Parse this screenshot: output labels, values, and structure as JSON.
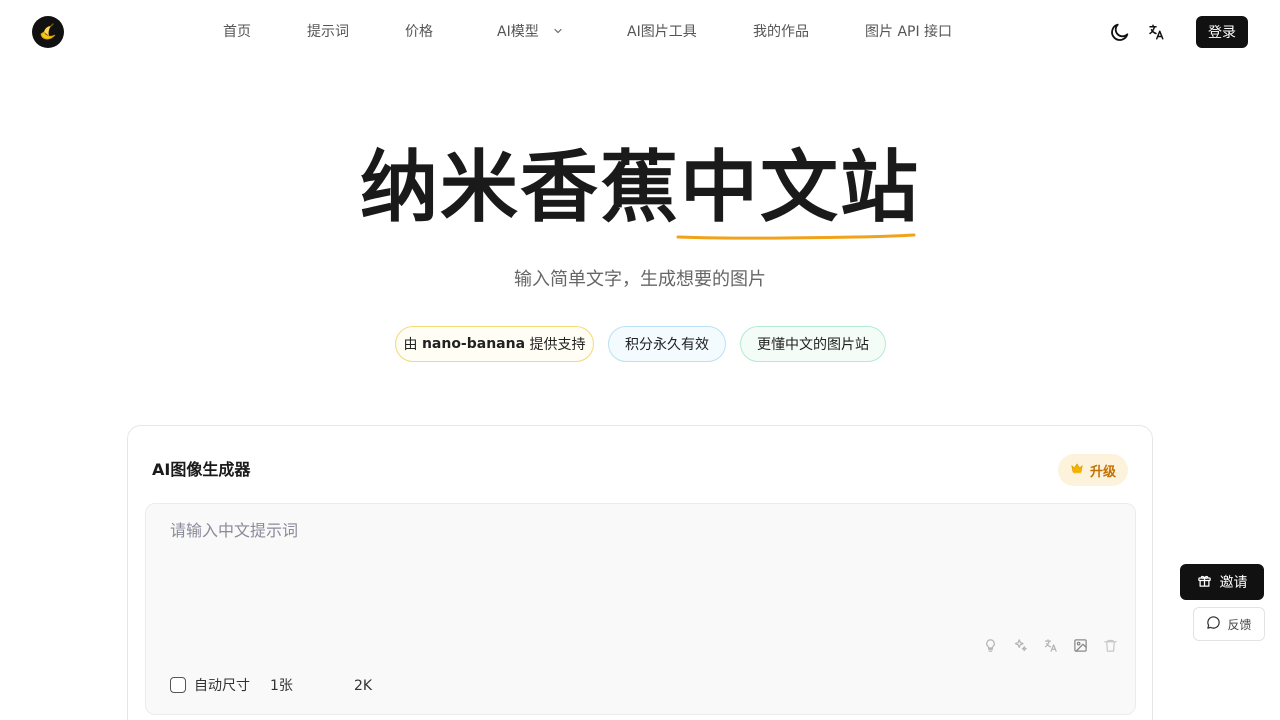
{
  "nav": {
    "logo_icon": "banana-logo-icon",
    "links": [
      {
        "label": "首页"
      },
      {
        "label": "提示词"
      },
      {
        "label": "价格"
      },
      {
        "label": "AI模型"
      },
      {
        "label": "AI图片工具"
      },
      {
        "label": "我的作品"
      },
      {
        "label": "图片 API 接口"
      }
    ],
    "theme_icon": "moon-icon",
    "language_icon": "translate-icon",
    "login_label": "登录"
  },
  "hero": {
    "title_main": "纳米香蕉",
    "title_accent": "中文站",
    "subtitle": "输入简单文字，生成想要的图片",
    "accent_color": "#f0a21a",
    "pills": [
      {
        "prefix": "由 ",
        "bold": "nano-banana",
        "suffix": " 提供支持"
      },
      {
        "text": "积分永久有效"
      },
      {
        "text": "更懂中文的图片站"
      }
    ]
  },
  "generator": {
    "title": "AI图像生成器",
    "upgrade_label": "升级",
    "upgrade_icon": "crown-icon",
    "prompt_placeholder": "请输入中文提示词",
    "prompt_value": "",
    "tools": [
      "lightbulb-icon",
      "sparkles-icon",
      "translate-icon",
      "image-icon",
      "trash-icon"
    ],
    "options": {
      "auto_size_label": "自动尺寸",
      "auto_size_checked": false,
      "count": "1张",
      "resolution": "2K"
    }
  },
  "floating": {
    "invite_label": "邀请",
    "invite_icon": "gift-icon",
    "feedback_label": "反馈",
    "feedback_icon": "message-circle-icon"
  }
}
